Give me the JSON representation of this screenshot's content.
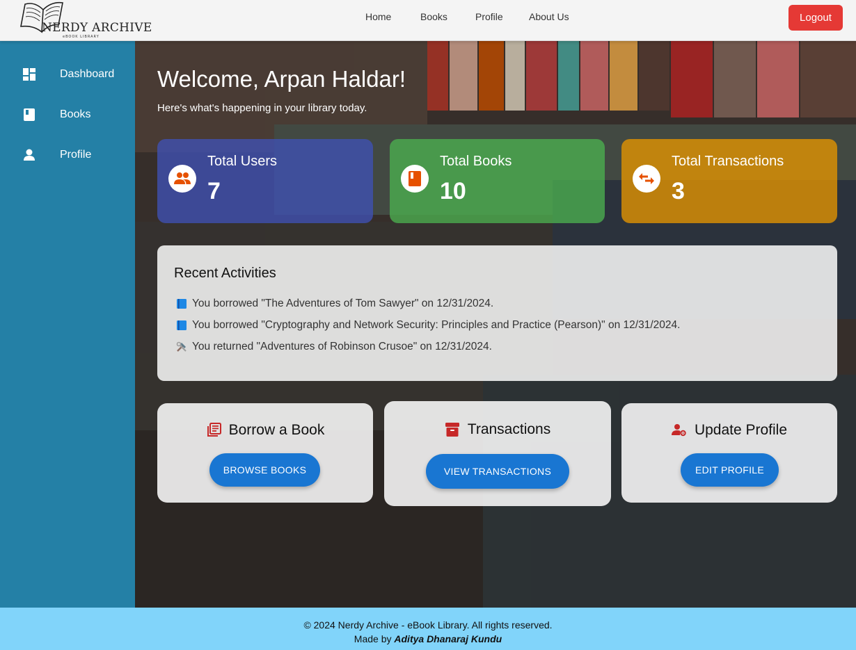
{
  "header": {
    "logo_title": "NERDY ARCHIVE",
    "logo_subtitle": "eBOOK LIBRARY",
    "nav": [
      "Home",
      "Books",
      "Profile",
      "About Us"
    ],
    "logout_label": "Logout"
  },
  "sidebar": {
    "items": [
      {
        "label": "Dashboard",
        "icon": "dashboard-icon"
      },
      {
        "label": "Books",
        "icon": "book-icon"
      },
      {
        "label": "Profile",
        "icon": "person-icon"
      }
    ]
  },
  "main": {
    "welcome": "Welcome, Arpan Haldar!",
    "subtitle": "Here's what's happening in your library today.",
    "stats": [
      {
        "label": "Total Users",
        "value": "7",
        "icon": "users-icon",
        "color": "#3f51b5"
      },
      {
        "label": "Total Books",
        "value": "10",
        "icon": "book-icon",
        "color": "#4caf50"
      },
      {
        "label": "Total Transactions",
        "value": "3",
        "icon": "swap-icon",
        "color": "#e69500"
      }
    ],
    "activities": {
      "title": "Recent Activities",
      "items": [
        {
          "icon": "blue-book-icon",
          "text": "You borrowed \"The Adventures of Tom Sawyer\" on 12/31/2024."
        },
        {
          "icon": "blue-book-icon",
          "text": "You borrowed \"Cryptography and Network Security: Principles and Practice (Pearson)\" on 12/31/2024."
        },
        {
          "icon": "tools-icon",
          "text": "You returned \"Adventures of Robinson Crusoe\" on 12/31/2024."
        }
      ]
    },
    "cards": [
      {
        "title": "Borrow a Book",
        "button": "BROWSE BOOKS",
        "icon": "library-books-icon"
      },
      {
        "title": "Transactions",
        "button": "VIEW TRANSACTIONS",
        "icon": "archive-icon"
      },
      {
        "title": "Update Profile",
        "button": "EDIT PROFILE",
        "icon": "manage-account-icon"
      }
    ]
  },
  "footer": {
    "copyright": "© 2024 Nerdy Archive - eBook Library. All rights reserved.",
    "made_by_prefix": "Made by",
    "author": "Aditya Dhanaraj Kundu"
  },
  "colors": {
    "sidebar": "#2480a6",
    "footer": "#81d4fa",
    "logout": "#e53935",
    "button": "#1976d2",
    "accent_icon": "#d32f2f"
  }
}
